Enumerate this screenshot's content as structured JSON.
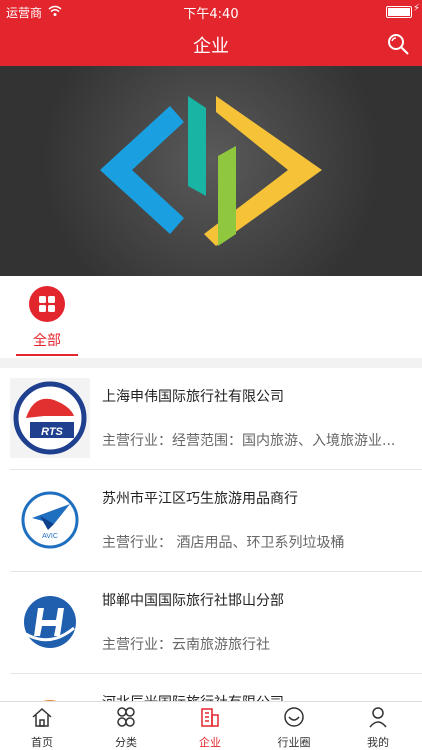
{
  "statusbar": {
    "carrier": "运营商",
    "time": "下午4:40"
  },
  "header": {
    "title": "企业"
  },
  "category_tabs": [
    {
      "label": "全部",
      "active": true
    }
  ],
  "companies": [
    {
      "name": "上海申伟国际旅行社有限公司",
      "industry": "主营行业：经营范围：国内旅游、入境旅游业...",
      "logo_text": "RTS"
    },
    {
      "name": "苏州市平江区巧生旅游用品商行",
      "industry": "主营行业：        酒店用品、环卫系列垃圾桶",
      "logo_text": "AVIC"
    },
    {
      "name": "邯郸中国国际旅行社邯山分部",
      "industry": "主营行业：云南旅游旅行社",
      "logo_text": ""
    },
    {
      "name": "河北辰光国际旅行社有限公司",
      "industry": "",
      "logo_text": ""
    }
  ],
  "tabbar": [
    {
      "label": "首页",
      "icon": "home-icon"
    },
    {
      "label": "分类",
      "icon": "category-icon"
    },
    {
      "label": "企业",
      "icon": "company-icon",
      "active": true
    },
    {
      "label": "行业圈",
      "icon": "circle-icon"
    },
    {
      "label": "我的",
      "icon": "user-icon"
    }
  ],
  "colors": {
    "accent": "#e3262d"
  }
}
